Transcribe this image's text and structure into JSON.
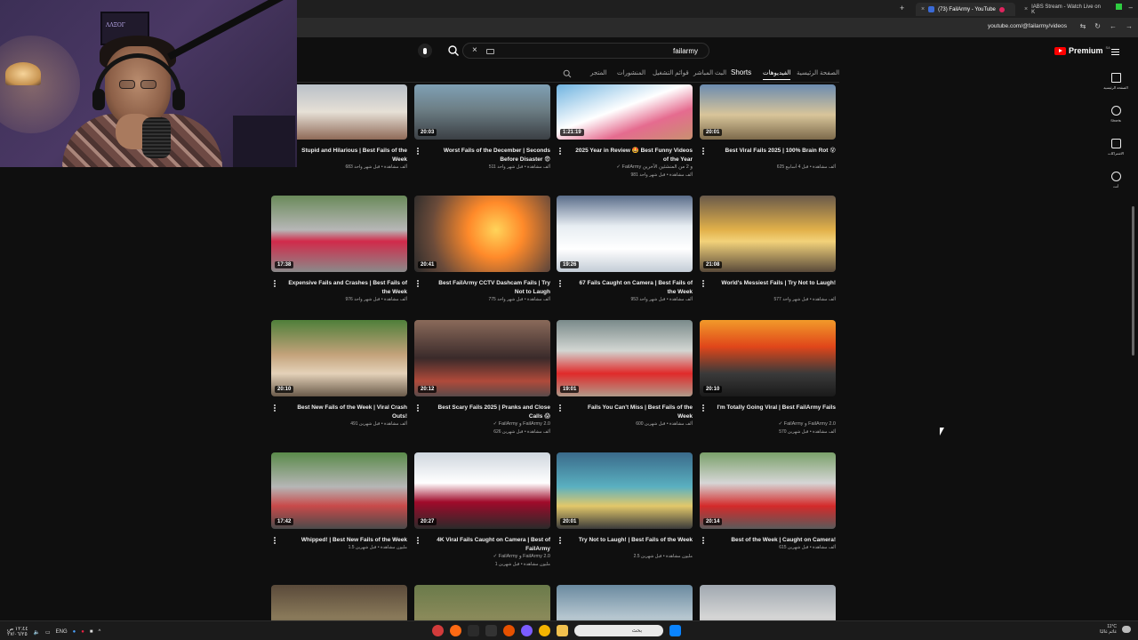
{
  "browser": {
    "tabs": [
      {
        "title": "(73) FailArmy - YouTube",
        "active": true
      },
      {
        "title": "IABS Stream - Watch Live on K",
        "active": false
      }
    ],
    "url": "youtube.com/@failarmy/videos"
  },
  "header": {
    "logo_text": "Premium",
    "logo_region": "SA",
    "search_value": "failarmy"
  },
  "channel_tabs": {
    "home": "الصفحة الرئيسية",
    "videos": "الفيديوهات",
    "shorts": "Shorts",
    "live": "البث المباشر",
    "playlists": "قوائم التشغيل",
    "posts": "المنشورات",
    "store": "المتجر"
  },
  "guide": {
    "home": "الصفحة الرئيسية",
    "shorts": "Shorts",
    "subs": "الاشتراكات",
    "you": "أنت"
  },
  "webcam": {
    "frame_text": "ΛΛΞΟΓ"
  },
  "videos": [
    {
      "title": "Stupid and Hilarious | Best Fails of the Week",
      "duration": "",
      "meta": "683 ألف مشاهدة • قبل شهر واحد",
      "channel": ""
    },
    {
      "title": "Worst Fails of the December | Seconds Before Disaster 😨",
      "duration": "20:03",
      "meta": "511 ألف مشاهدة • قبل شهر واحد",
      "channel": ""
    },
    {
      "title": "2025 Year in Review 🤩 Best Funny Videos of the Year",
      "duration": "1:21:19",
      "meta": "981 ألف مشاهدة • قبل شهر واحد",
      "channel": "FailArmy و 2 من المنشئين الآخرين"
    },
    {
      "title": "Best Viral Fails 2025 | 100% Brain Rot 😵",
      "duration": "20:01",
      "meta": "625 ألف مشاهدة • قبل 4 أسابيع",
      "channel": ""
    },
    {
      "title": "Expensive Fails and Crashes | Best Fails of the Week",
      "duration": "17:38",
      "meta": "976 ألف مشاهدة • قبل شهر واحد",
      "channel": ""
    },
    {
      "title": "Best FailArmy CCTV Dashcam Fails | Try Not to Laugh",
      "duration": "20:41",
      "meta": "775 ألف مشاهدة • قبل شهر واحد",
      "channel": ""
    },
    {
      "title": "67 Fails Caught on Camera | Best Fails of the Week",
      "duration": "19:26",
      "meta": "953 ألف مشاهدة • قبل شهر واحد",
      "channel": ""
    },
    {
      "title": "World's Messiest Fails | Try Not to Laugh!",
      "duration": "21:08",
      "meta": "577 ألف مشاهدة • قبل شهر واحد",
      "channel": ""
    },
    {
      "title": "Best New Fails of the Week | Viral Crash Outs!",
      "duration": "20:10",
      "meta": "491 ألف مشاهدة • قبل شهرين",
      "channel": ""
    },
    {
      "title": "Best Scary Fails 2025 | Pranks and Close Calls 😱",
      "duration": "20:12",
      "meta": "626 ألف مشاهدة • قبل شهرين",
      "channel": "FailArmy و FailArmy 2.0"
    },
    {
      "title": "Fails You Can't Miss | Best Fails of the Week",
      "duration": "19:01",
      "meta": "600 ألف مشاهدة • قبل شهرين",
      "channel": ""
    },
    {
      "title": "I'm Totally Going Viral | Best FailArmy Fails",
      "duration": "20:10",
      "meta": "570 ألف مشاهدة • قبل شهرين",
      "channel": "FailArmy و FailArmy 2.0"
    },
    {
      "title": "Whipped! | Best New Fails of the Week",
      "duration": "17:42",
      "meta": "1.5 مليون مشاهدة • قبل شهرين",
      "channel": ""
    },
    {
      "title": "4K Viral Fails Caught on Camera | Best of FailArmy",
      "duration": "20:27",
      "meta": "1 مليون مشاهدة • قبل شهرين",
      "channel": "FailArmy و FailArmy 2.0"
    },
    {
      "title": "Try Not to Laugh! | Best Fails of the Week",
      "duration": "20:01",
      "meta": "2.5 مليون مشاهدة • قبل شهرين",
      "channel": ""
    },
    {
      "title": "Best of the Week | Caught on Camera!",
      "duration": "20:14",
      "meta": "615 ألف مشاهدة • قبل شهرين",
      "channel": ""
    },
    {
      "title": "",
      "duration": "",
      "meta": "",
      "channel": ""
    },
    {
      "title": "",
      "duration": "",
      "meta": "",
      "channel": ""
    },
    {
      "title": "",
      "duration": "",
      "meta": "",
      "channel": ""
    },
    {
      "title": "",
      "duration": "",
      "meta": "",
      "channel": ""
    }
  ],
  "taskbar": {
    "language": "ENG",
    "search_placeholder": "بحث",
    "time": "١٢:٤٤ ص",
    "date": "٢٧/٠٦/٢٥",
    "weather": "11°C",
    "weather_desc": "غائم غالبًا"
  },
  "colors": {
    "background": "#0f0f0f",
    "text": "#f1f1f1",
    "muted": "#aaaaaa",
    "brand": "#ff0000"
  }
}
